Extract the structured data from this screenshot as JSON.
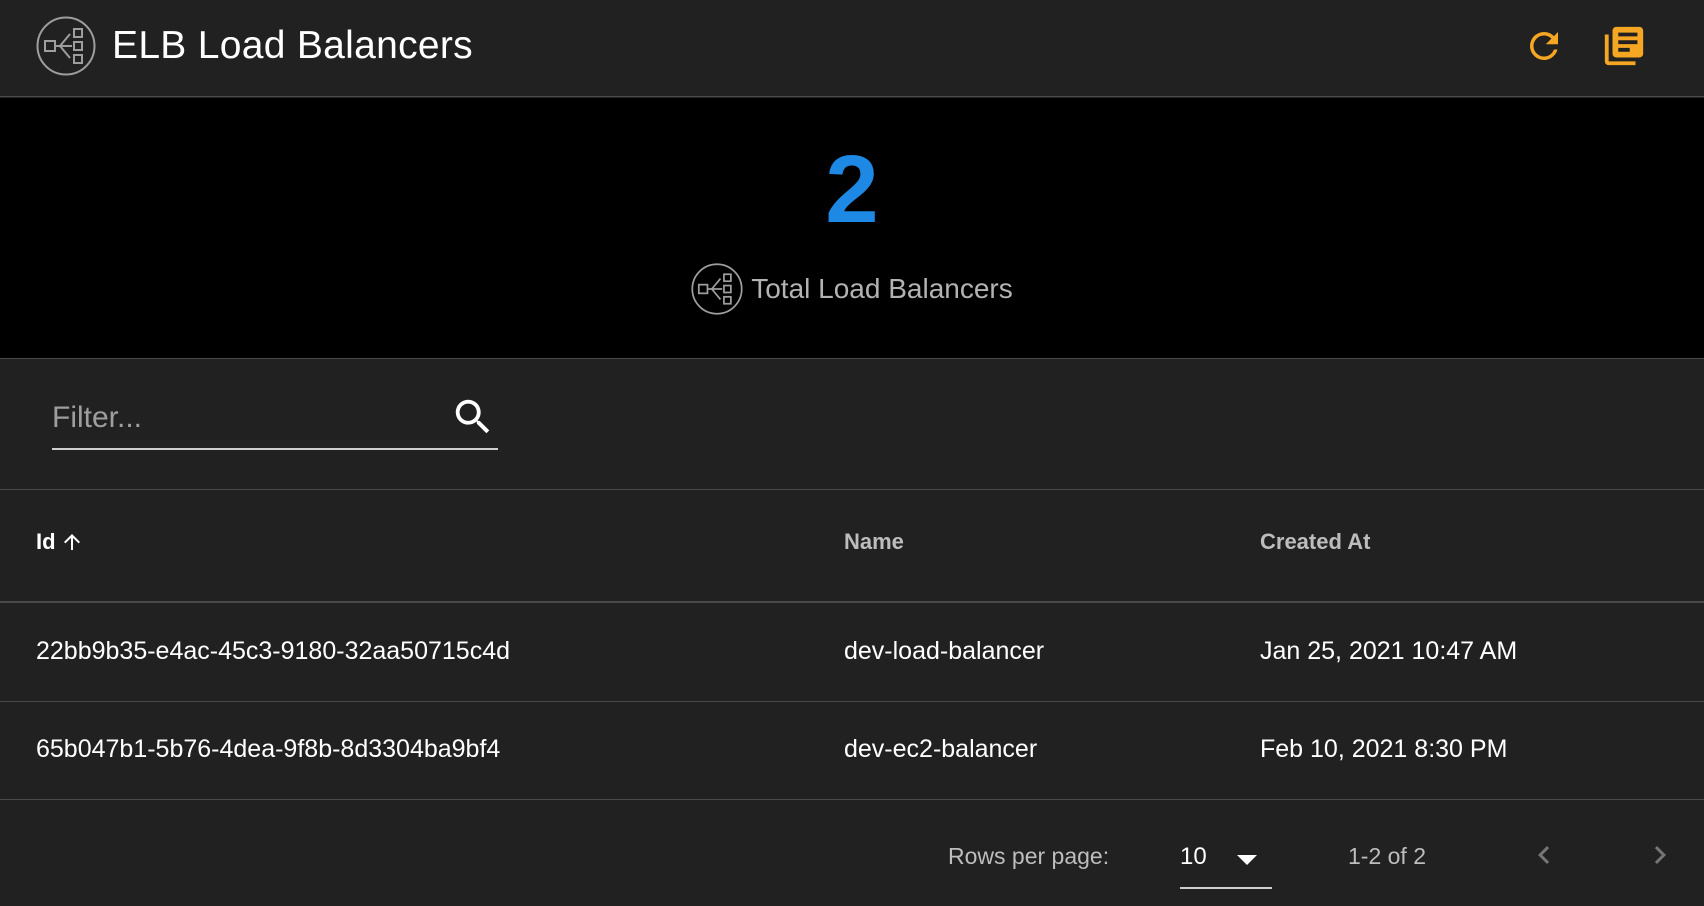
{
  "header": {
    "title": "ELB Load Balancers",
    "logo_icon": "load-balancer-icon",
    "actions": [
      {
        "name": "refresh",
        "icon": "refresh-icon",
        "color": "#f5a623"
      },
      {
        "name": "docs",
        "icon": "library-books-icon",
        "color": "#f5a623"
      }
    ]
  },
  "summary": {
    "count": "2",
    "count_color": "#1e88e5",
    "label": "Total Load Balancers",
    "icon": "load-balancer-icon"
  },
  "filter": {
    "placeholder": "Filter...",
    "value": "",
    "icon": "search-icon"
  },
  "table": {
    "columns": [
      {
        "label": "Id",
        "sorted": "asc",
        "sort_icon": "arrow-up-icon"
      },
      {
        "label": "Name"
      },
      {
        "label": "Created At"
      }
    ],
    "rows": [
      {
        "id": "22bb9b35-e4ac-45c3-9180-32aa50715c4d",
        "name": "dev-load-balancer",
        "created_at": "Jan 25, 2021 10:47 AM"
      },
      {
        "id": "65b047b1-5b76-4dea-9f8b-8d3304ba9bf4",
        "name": "dev-ec2-balancer",
        "created_at": "Feb 10, 2021 8:30 PM"
      }
    ]
  },
  "pagination": {
    "rows_per_page_label": "Rows per page:",
    "rows_per_page": "10",
    "range": "1-2 of 2",
    "prev_icon": "chevron-left-icon",
    "next_icon": "chevron-right-icon"
  }
}
